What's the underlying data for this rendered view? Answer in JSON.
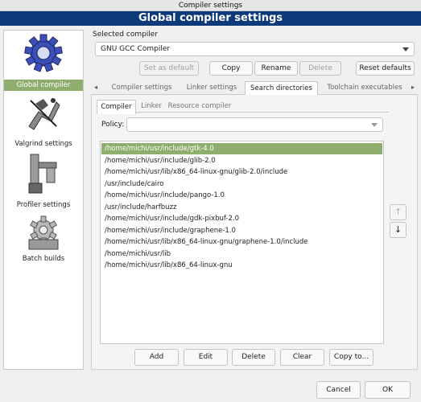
{
  "window": {
    "title": "Compiler settings",
    "banner": "Global compiler settings"
  },
  "sidebar": {
    "items": [
      {
        "label": "Global compiler settings",
        "icon": "gear-icon",
        "selected": true
      },
      {
        "label": "Valgrind settings",
        "icon": "valgrind-icon"
      },
      {
        "label": "Profiler settings",
        "icon": "profiler-icon"
      },
      {
        "label": "Batch builds",
        "icon": "batch-builds-icon"
      }
    ]
  },
  "compiler": {
    "section_label": "Selected compiler",
    "selected": "GNU GCC Compiler",
    "buttons": {
      "set_default": "Set as default",
      "copy": "Copy",
      "rename": "Rename",
      "delete": "Delete",
      "reset": "Reset defaults"
    }
  },
  "tabs": [
    "Compiler settings",
    "Linker settings",
    "Search directories",
    "Toolchain executables"
  ],
  "tab_nav": {
    "left": "◂",
    "right": "▸"
  },
  "subtabs": [
    "Compiler",
    "Linker",
    "Resource compiler"
  ],
  "policy": {
    "label": "Policy:",
    "value": ""
  },
  "directories": [
    "/home/michi/usr/include/gtk-4.0",
    "/home/michi/usr/include/glib-2.0",
    "/home/michi/usr/lib/x86_64-linux-gnu/glib-2.0/include",
    "/usr/include/cairo",
    "/home/michi/usr/include/pango-1.0",
    "/usr/include/harfbuzz",
    "/home/michi/usr/include/gdk-pixbuf-2.0",
    "/home/michi/usr/include/graphene-1.0",
    "/home/michi/usr/lib/x86_64-linux-gnu/graphene-1.0/include",
    "/home/michi/usr/lib",
    "/home/michi/usr/lib/x86_64-linux-gnu"
  ],
  "move": {
    "up": "↑",
    "down": "↓"
  },
  "list_buttons": {
    "add": "Add",
    "edit": "Edit",
    "delete": "Delete",
    "clear": "Clear",
    "copy_to": "Copy to..."
  },
  "dialog": {
    "cancel": "Cancel",
    "ok": "OK"
  }
}
